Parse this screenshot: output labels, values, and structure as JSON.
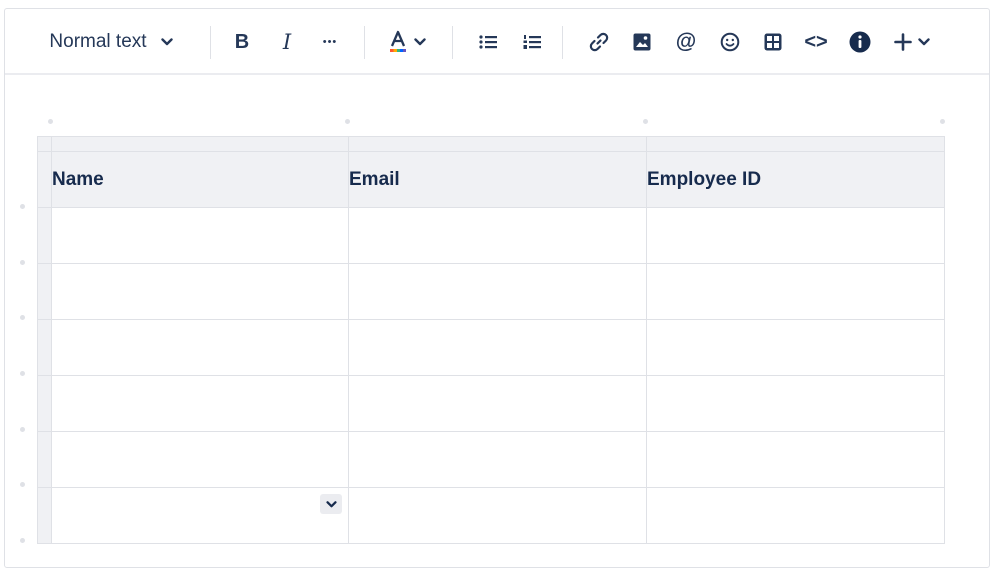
{
  "toolbar": {
    "text_style": "Normal text",
    "bold_label": "B",
    "italic_label": "I",
    "more_label": "•••",
    "mention_label": "@",
    "code_label": "<>",
    "icons": [
      "chevron-down-icon",
      "bold-icon",
      "italic-icon",
      "more-icon",
      "text-color-icon",
      "bullet-list-icon",
      "numbered-list-icon",
      "link-icon",
      "image-icon",
      "mention-icon",
      "emoji-icon",
      "table-icon",
      "code-icon",
      "info-icon",
      "plus-icon"
    ],
    "text_color_bar": [
      "#ff5630",
      "#ffab00",
      "#36b37e",
      "#0065ff",
      "#6554c0"
    ]
  },
  "table": {
    "headers": [
      "Name",
      "Email",
      "Employee ID"
    ],
    "rows": [
      [
        "",
        "",
        ""
      ],
      [
        "",
        "",
        ""
      ],
      [
        "",
        "",
        ""
      ],
      [
        "",
        "",
        ""
      ],
      [
        "",
        "",
        ""
      ],
      [
        "",
        "",
        ""
      ]
    ]
  }
}
